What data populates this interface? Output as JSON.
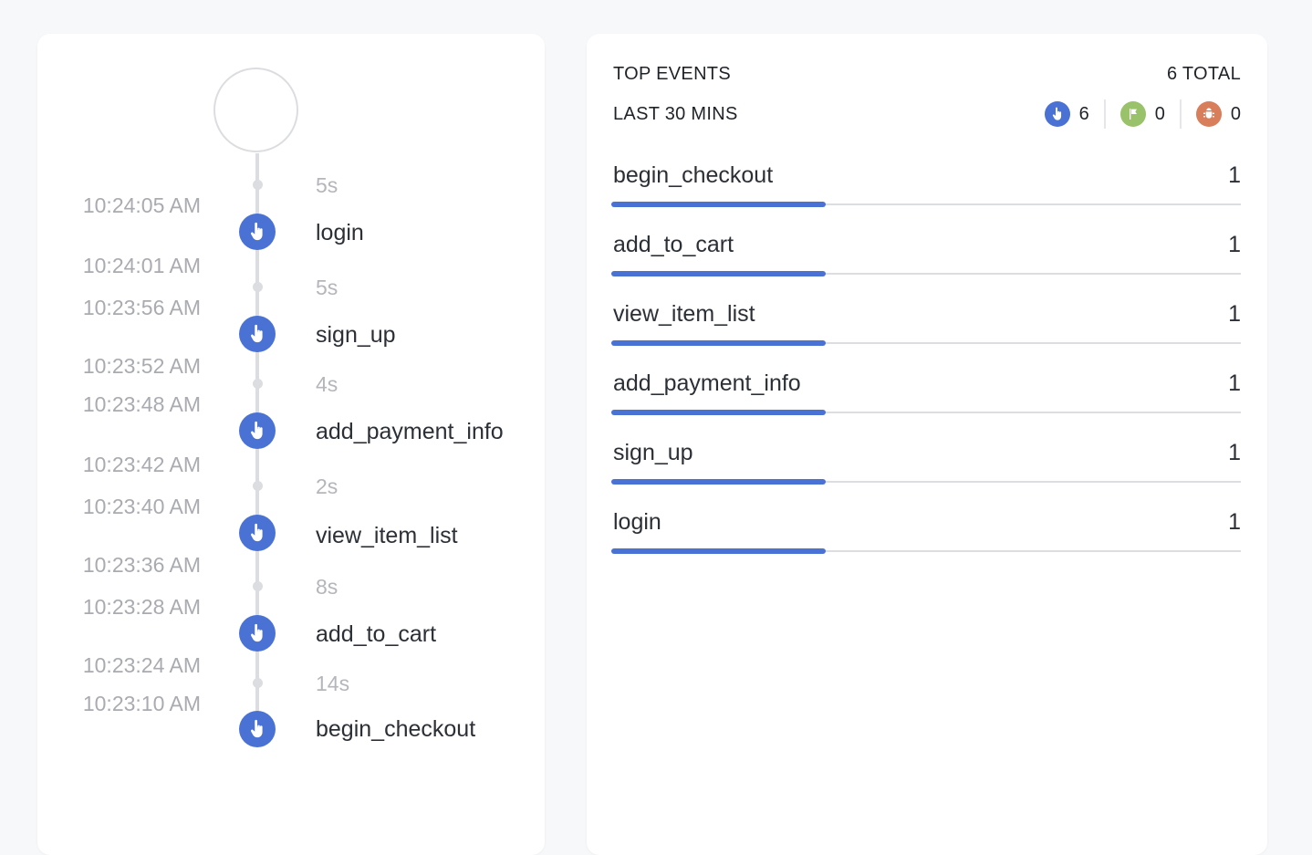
{
  "timeline": {
    "events": [
      {
        "name": "login",
        "icon": "pointer-hand-icon"
      },
      {
        "name": "sign_up",
        "icon": "pointer-hand-icon"
      },
      {
        "name": "add_payment_info",
        "icon": "pointer-hand-icon"
      },
      {
        "name": "view_item_list",
        "icon": "pointer-hand-icon"
      },
      {
        "name": "add_to_cart",
        "icon": "pointer-hand-icon"
      },
      {
        "name": "begin_checkout",
        "icon": "pointer-hand-icon"
      }
    ],
    "gaps": [
      "5s",
      "5s",
      "4s",
      "2s",
      "8s",
      "14s"
    ],
    "times": [
      "10:24:05 AM",
      "10:24:01 AM",
      "10:23:56 AM",
      "10:23:52 AM",
      "10:23:48 AM",
      "10:23:42 AM",
      "10:23:40 AM",
      "10:23:36 AM",
      "10:23:28 AM",
      "10:23:24 AM",
      "10:23:10 AM"
    ]
  },
  "top_events": {
    "title": "TOP EVENTS",
    "total_label": "6 TOTAL",
    "period": "LAST 30 MINS",
    "counts": [
      {
        "icon": "pointer-hand-icon",
        "value": "6",
        "color": "#4a72d5"
      },
      {
        "icon": "flag-icon",
        "value": "0",
        "color": "#9ac26a"
      },
      {
        "icon": "bug-icon",
        "value": "0",
        "color": "#d97e5a"
      }
    ],
    "events": [
      {
        "name": "begin_checkout",
        "count": "1",
        "share": 0.34
      },
      {
        "name": "add_to_cart",
        "count": "1",
        "share": 0.34
      },
      {
        "name": "view_item_list",
        "count": "1",
        "share": 0.34
      },
      {
        "name": "add_payment_info",
        "count": "1",
        "share": 0.34
      },
      {
        "name": "sign_up",
        "count": "1",
        "share": 0.34
      },
      {
        "name": "login",
        "count": "1",
        "share": 0.34
      }
    ],
    "bar_color": "#4a72d5"
  }
}
